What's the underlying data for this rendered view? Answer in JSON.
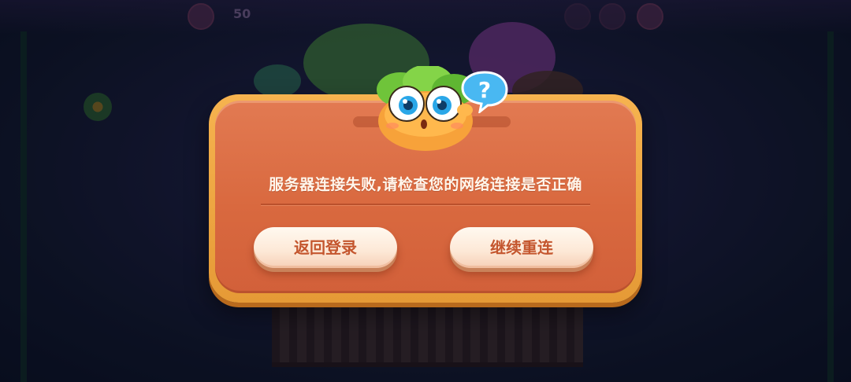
{
  "background": {
    "score": "50"
  },
  "dialog": {
    "message": "服务器连接失败,请检查您的网络连接是否正确",
    "back_to_login_label": "返回登录",
    "reconnect_label": "继续重连",
    "mascot_question_mark": "?"
  },
  "colors": {
    "dialog_border": "#f6b34f",
    "dialog_body": "#d9693f",
    "button_bg": "#fdeada",
    "button_text": "#c4562e",
    "message_text": "#fff6ec"
  },
  "icons": [
    "question-bubble-icon",
    "carrot-mascot-icon"
  ]
}
